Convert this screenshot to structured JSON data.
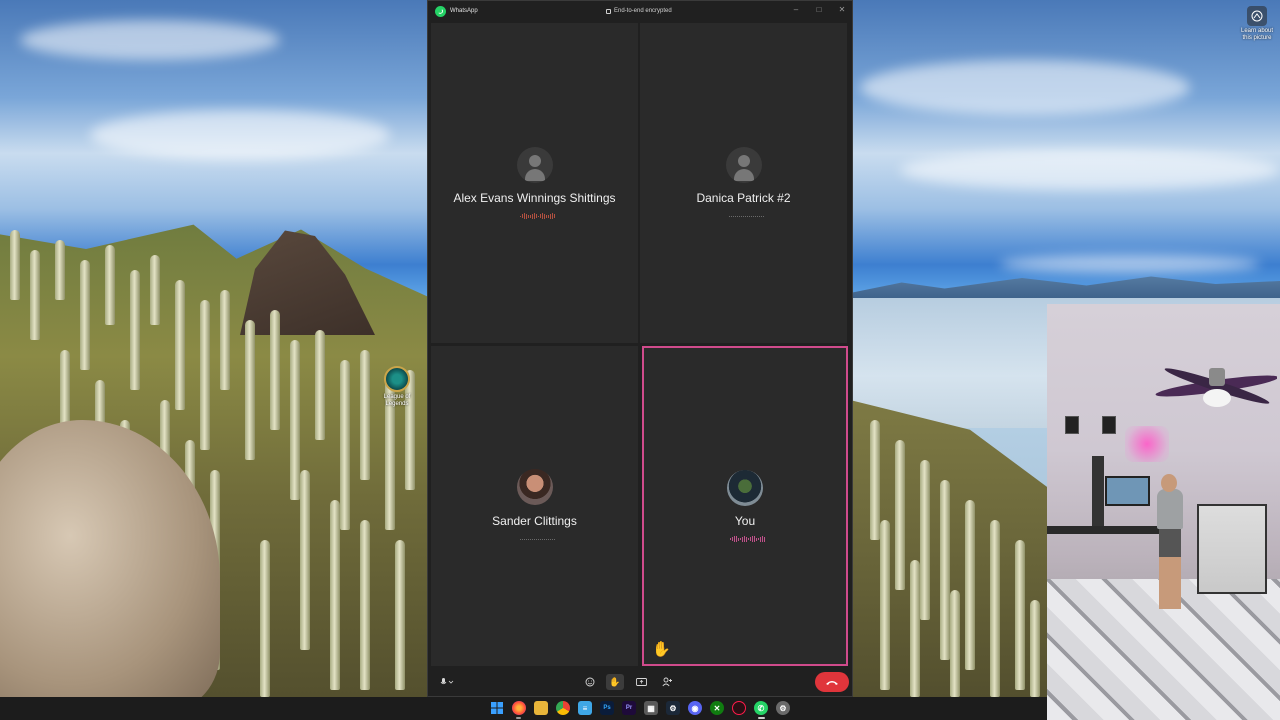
{
  "desktop": {
    "shortcut_label": "League of Legends",
    "learn_picture_label": "Learn about this picture"
  },
  "whatsapp": {
    "app_name": "WhatsApp",
    "encryption_label": "End-to-end encrypted",
    "participants": [
      {
        "name": "Alex Evans Winnings Shittings",
        "avatar": "default-avatar-icon",
        "speaking": true
      },
      {
        "name": "Danica Patrick #2",
        "avatar": "default-avatar-icon",
        "speaking": false
      },
      {
        "name": "Sander Clittings",
        "avatar": "profile-photo",
        "speaking": false
      },
      {
        "name": "You",
        "avatar": "profile-photo",
        "speaking": true,
        "hand_raised": true
      }
    ],
    "controls": {
      "mic": "microphone-icon",
      "emoji": "emoji-icon",
      "raise_hand": "raise-hand-icon",
      "share_screen": "share-screen-icon",
      "add_people": "add-people-icon",
      "end_call": "end-call-icon"
    },
    "colors": {
      "end_call": "#e0353b",
      "active_speaker_border": "#d04b8c",
      "brand": "#25d366"
    }
  },
  "taskbar": {
    "apps": [
      "windows-start-icon",
      "firefox-icon",
      "file-explorer-icon",
      "chrome-icon",
      "notepad-icon",
      "photoshop-icon",
      "premiere-icon",
      "calculator-icon",
      "steam-icon",
      "discord-icon",
      "xbox-icon",
      "opera-gx-icon",
      "whatsapp-icon",
      "settings-icon"
    ]
  }
}
